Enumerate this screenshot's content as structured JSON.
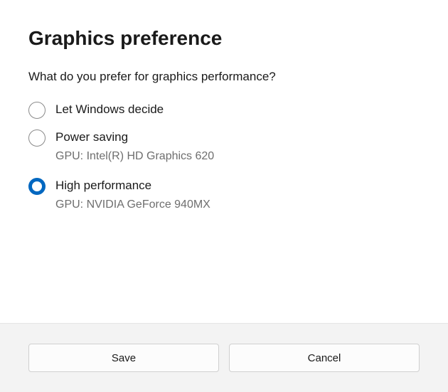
{
  "title": "Graphics preference",
  "question": "What do you prefer for graphics performance?",
  "options": [
    {
      "label": "Let Windows decide",
      "sublabel": "",
      "selected": false
    },
    {
      "label": "Power saving",
      "sublabel": "GPU: Intel(R) HD Graphics 620",
      "selected": false
    },
    {
      "label": "High performance",
      "sublabel": "GPU: NVIDIA GeForce 940MX",
      "selected": true
    }
  ],
  "buttons": {
    "save": "Save",
    "cancel": "Cancel"
  }
}
